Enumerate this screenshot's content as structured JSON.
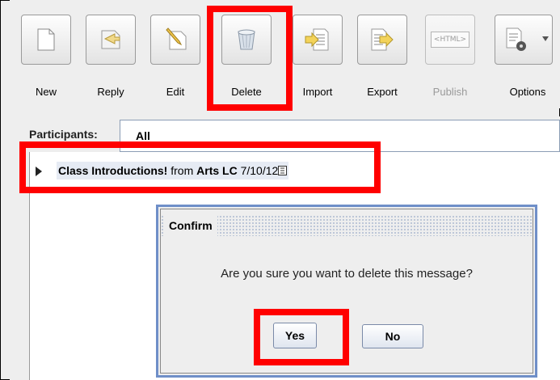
{
  "toolbar": {
    "buttons": [
      {
        "label": "New",
        "icon": "new-document-icon"
      },
      {
        "label": "Reply",
        "icon": "reply-icon"
      },
      {
        "label": "Edit",
        "icon": "edit-pencil-icon"
      },
      {
        "label": "Delete",
        "icon": "trash-icon"
      },
      {
        "label": "Import",
        "icon": "import-icon"
      },
      {
        "label": "Export",
        "icon": "export-icon"
      },
      {
        "label": "Publish",
        "icon": "html-publish-icon",
        "icon_text": "<HTML>"
      },
      {
        "label": "Options",
        "icon": "options-gear-icon"
      }
    ]
  },
  "participants": {
    "label": "Participants:",
    "value": "All"
  },
  "message": {
    "subject": "Class Introductions!",
    "from_word": "from",
    "author": "Arts LC",
    "date": "7/10/12"
  },
  "dialog": {
    "title": "Confirm",
    "text": "Are you sure you want to delete this message?",
    "yes_label": "Yes",
    "no_label": "No"
  },
  "colors": {
    "highlight": "#ff0000",
    "dialog_border": "#6f8fc8"
  }
}
